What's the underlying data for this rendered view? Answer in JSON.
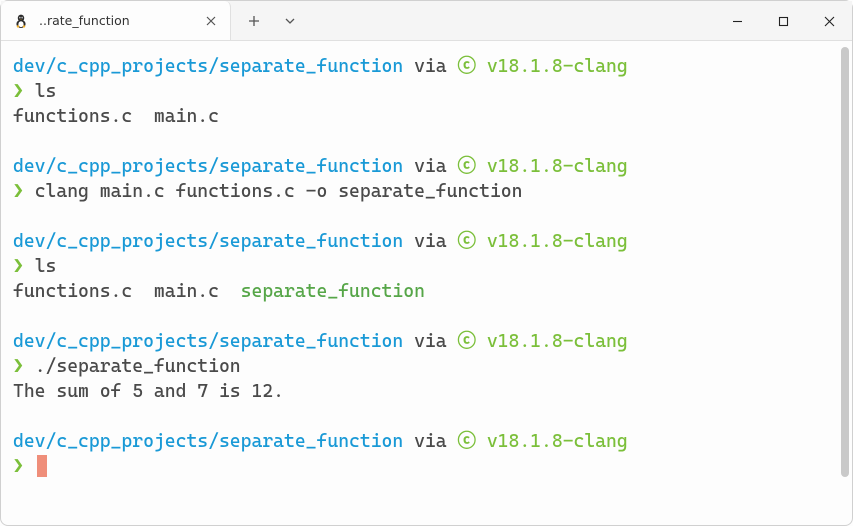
{
  "titlebar": {
    "tab_label": "..rate_function",
    "tab_icon": "tux-icon",
    "new_tab": "+",
    "dropdown": "⌄"
  },
  "colors": {
    "path": "#1999d6",
    "accent": "#7bbf3a",
    "exec": "#56a648",
    "text": "#4a4a4a",
    "cursor": "#ef8e7a"
  },
  "prompt": {
    "path": "dev/c_cpp_projects/separate_function",
    "via": "via",
    "c_glyph": "ⓒ",
    "version": "v18.1.8-clang",
    "symbol": "❯"
  },
  "blocks": [
    {
      "cmd": "ls",
      "output_plain": "functions.c  main.c",
      "output_exec": ""
    },
    {
      "cmd": "clang main.c functions.c -o separate_function",
      "output_plain": "",
      "output_exec": ""
    },
    {
      "cmd": "ls",
      "output_plain": "functions.c  main.c  ",
      "output_exec": "separate_function"
    },
    {
      "cmd": "./separate_function",
      "output_plain": "The sum of 5 and 7 is 12.",
      "output_exec": ""
    }
  ]
}
